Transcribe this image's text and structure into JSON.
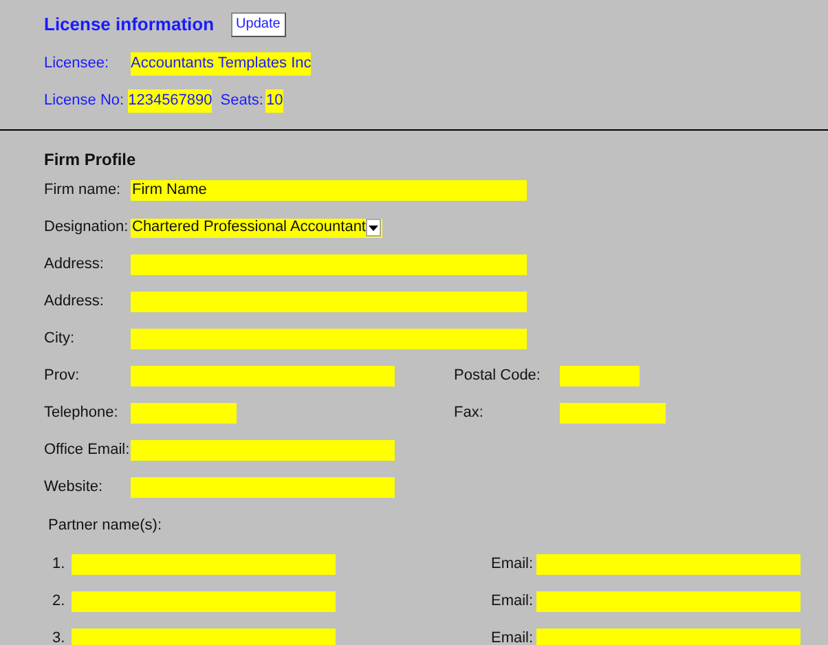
{
  "license": {
    "title": "License information",
    "update_button": "Update",
    "licensee_label": "Licensee:",
    "licensee": "Accountants Templates Inc",
    "license_no_label": "License No:",
    "license_no": "1234567890",
    "seats_label": "Seats:",
    "seats": "10"
  },
  "firm_profile": {
    "title": "Firm Profile",
    "rows": [
      {
        "label": "Firm name:",
        "kind": "wide",
        "value": "Firm Name"
      },
      {
        "label": "Designation:",
        "kind": "select",
        "value": "Chartered Professional Accountant"
      },
      {
        "label": "Address:",
        "kind": "wide"
      },
      {
        "label": "Address:",
        "kind": "wide"
      },
      {
        "label": "City:",
        "kind": "wide"
      },
      {
        "label": "Prov:",
        "kind": "medium",
        "side": {
          "label": "Postal Code:",
          "kind": "short"
        }
      },
      {
        "label": "Telephone:",
        "kind": "phone",
        "side": {
          "label": "Fax:",
          "kind": "phone"
        }
      },
      {
        "label": "Office Email:",
        "kind": "medium"
      },
      {
        "label": "Website:",
        "kind": "medium"
      }
    ]
  },
  "partners": {
    "title": "Partner name(s):",
    "rows": [
      {
        "number": "1.",
        "email_label": "Email:"
      },
      {
        "number": "2.",
        "email_label": "Email:"
      },
      {
        "number": "3.",
        "email_label": "Email:"
      }
    ]
  }
}
